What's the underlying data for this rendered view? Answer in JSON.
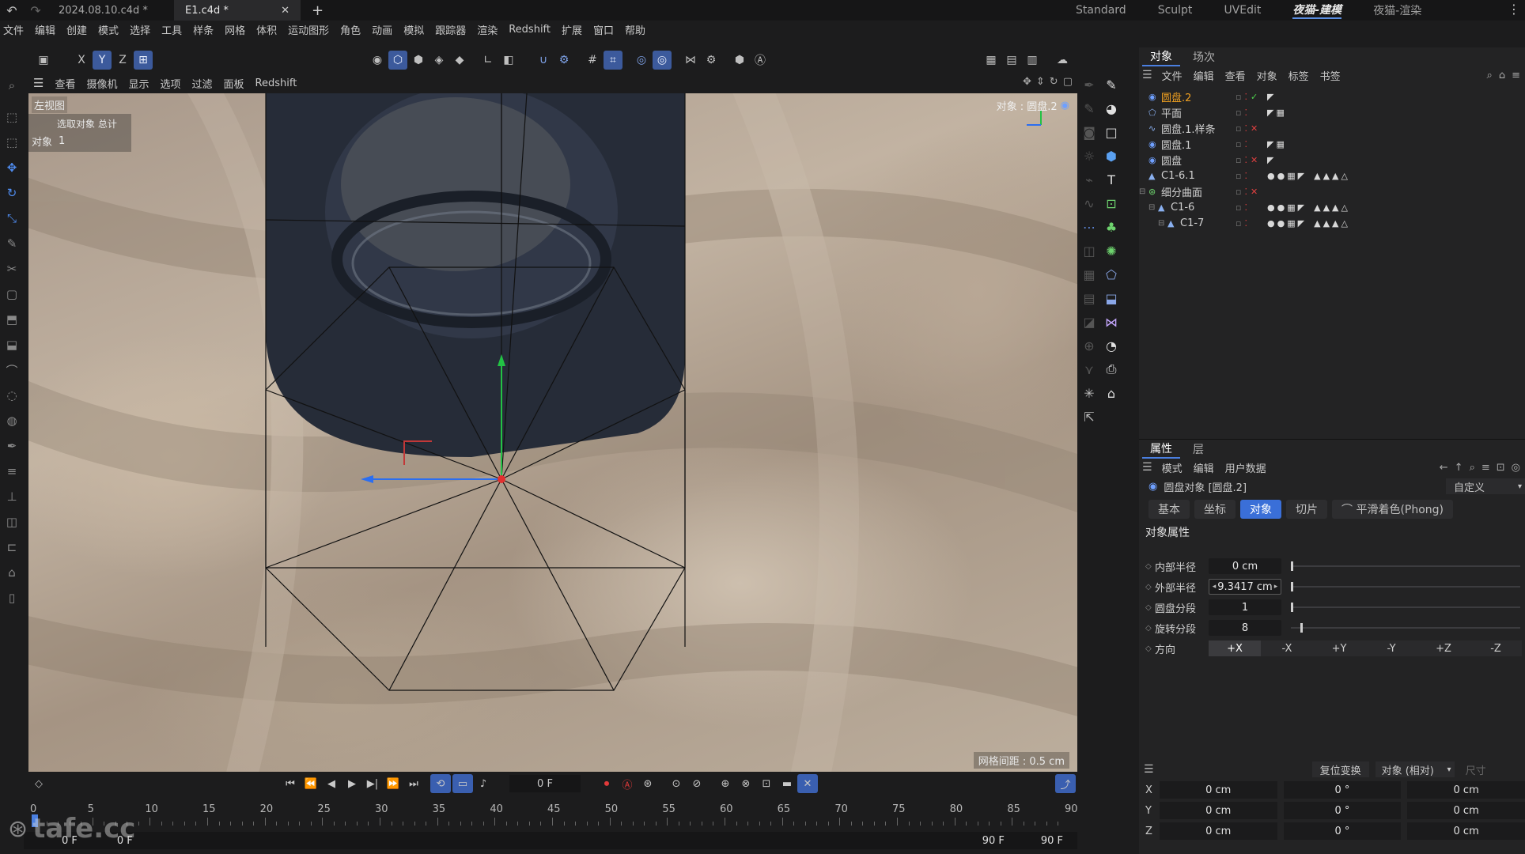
{
  "titlebar": {
    "file_tabs": [
      {
        "label": "2024.08.10.c4d *",
        "active": false
      },
      {
        "label": "E1.c4d *",
        "active": true
      }
    ],
    "layouts": [
      "Standard",
      "Sculpt",
      "UVEdit",
      "夜猫-建模",
      "夜猫-渲染"
    ],
    "active_layout_index": 3
  },
  "menubar": {
    "items": [
      "文件",
      "编辑",
      "创建",
      "模式",
      "选择",
      "工具",
      "样条",
      "网格",
      "体积",
      "运动图形",
      "角色",
      "动画",
      "模拟",
      "跟踪器",
      "渲染",
      "Redshift",
      "扩展",
      "窗口",
      "帮助"
    ]
  },
  "axis_buttons": [
    "X",
    "Y",
    "Z"
  ],
  "viewport": {
    "menu": [
      "查看",
      "摄像机",
      "显示",
      "选项",
      "过滤",
      "面板",
      "Redshift"
    ],
    "view_name": "左视图",
    "hud_selected_label": "选取对象 总计",
    "hud_object_label": "对象",
    "hud_object_count": "1",
    "top_right_label": "对象 : 圆盘.2",
    "grid_spacing": "网格间距 : 0.5 cm"
  },
  "object_manager": {
    "tabs": [
      "对象",
      "场次"
    ],
    "menu": [
      "文件",
      "编辑",
      "查看",
      "对象",
      "标签",
      "书签"
    ],
    "objects": [
      {
        "name": "圆盘.2",
        "indent": 0,
        "selected": true,
        "icon": "disc-icon",
        "check": "green"
      },
      {
        "name": "平面",
        "indent": 0,
        "selected": false,
        "icon": "plane-icon",
        "check": "none"
      },
      {
        "name": "圆盘.1.样条",
        "indent": 0,
        "selected": false,
        "icon": "spline-icon",
        "check": "red"
      },
      {
        "name": "圆盘.1",
        "indent": 0,
        "selected": false,
        "icon": "disc-icon",
        "check": "none"
      },
      {
        "name": "圆盘",
        "indent": 0,
        "selected": false,
        "icon": "disc-icon",
        "check": "red"
      },
      {
        "name": "C1-6.1",
        "indent": 0,
        "selected": false,
        "icon": "polygon-icon",
        "check": "none"
      },
      {
        "name": "细分曲面",
        "indent": 0,
        "selected": false,
        "icon": "subdivision-icon",
        "check": "red"
      },
      {
        "name": "C1-6",
        "indent": 1,
        "selected": false,
        "icon": "polygon-icon",
        "check": "none"
      },
      {
        "name": "C1-7",
        "indent": 2,
        "selected": false,
        "icon": "polygon-icon",
        "check": "none"
      }
    ]
  },
  "attributes": {
    "tabs": [
      "属性",
      "层"
    ],
    "menu": [
      "模式",
      "编辑",
      "用户数据"
    ],
    "object_title": "圆盘对象 [圆盘.2]",
    "preset": "自定义",
    "sub_tabs": [
      "基本",
      "坐标",
      "对象",
      "切片",
      "平滑着色(Phong)"
    ],
    "active_sub_tab_index": 2,
    "section_title": "对象属性",
    "fields": [
      {
        "label": "内部半径",
        "value": "0 cm",
        "slider": 0.0
      },
      {
        "label": "外部半径",
        "value": "9.3417 cm",
        "slider": 0.0
      },
      {
        "label": "圆盘分段",
        "value": "1",
        "slider": 0.0
      },
      {
        "label": "旋转分段",
        "value": "8",
        "slider": 0.04
      }
    ],
    "direction_label": "方向",
    "directions": [
      "+X",
      "-X",
      "+Y",
      "-Y",
      "+Z",
      "-Z"
    ],
    "active_direction_index": 0
  },
  "coordinates": {
    "reset_button": "复位变换",
    "mode_select": "对象 (相对)",
    "size_label": "尺寸",
    "rows": [
      {
        "axis": "X",
        "pos": "0 cm",
        "rot": "0 °",
        "size": "0 cm"
      },
      {
        "axis": "Y",
        "pos": "0 cm",
        "rot": "0 °",
        "size": "0 cm"
      },
      {
        "axis": "Z",
        "pos": "0 cm",
        "rot": "0 °",
        "size": "0 cm"
      }
    ]
  },
  "timeline": {
    "current_frame": "0 F",
    "ticks": [
      "0",
      "5",
      "10",
      "15",
      "20",
      "25",
      "30",
      "35",
      "40",
      "45",
      "50",
      "55",
      "60",
      "65",
      "70",
      "75",
      "80",
      "85",
      "90"
    ],
    "range_start": "0 F",
    "range_start_2": "0 F",
    "range_end": "90 F",
    "range_end_2": "90 F"
  },
  "watermark": "tafe.cc",
  "colors": {
    "accent_blue": "#3a6fd8",
    "selected_orange": "#f0a020",
    "wire_black": "#111111",
    "axis_green": "#22c244",
    "axis_blue": "#2b6ef0",
    "axis_red": "#e23030"
  }
}
